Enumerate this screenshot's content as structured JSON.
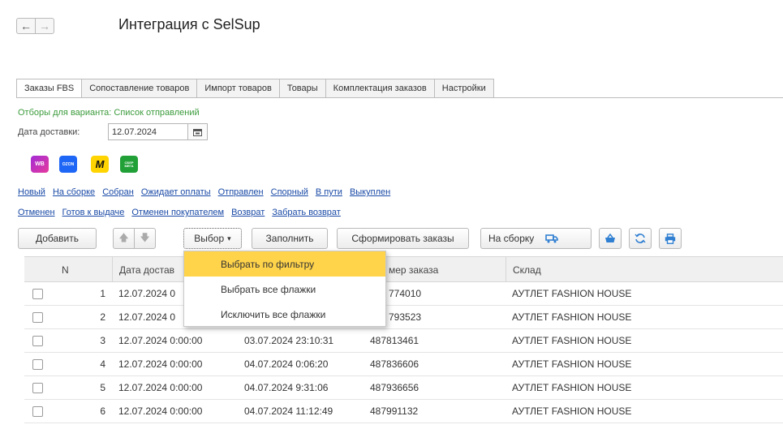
{
  "window": {
    "title": "Интеграция с SelSup",
    "back_glyph": "←",
    "forward_glyph": "→"
  },
  "tabs": [
    {
      "label": "Заказы FBS",
      "active": true
    },
    {
      "label": "Сопоставление товаров",
      "active": false
    },
    {
      "label": "Импорт товаров",
      "active": false
    },
    {
      "label": "Товары",
      "active": false
    },
    {
      "label": "Комплектация заказов",
      "active": false
    },
    {
      "label": "Настройки",
      "active": false
    }
  ],
  "filters": {
    "caption": "Отборы для варианта: Список отправлений",
    "date_label": "Дата доставки:",
    "date_value": "12.07.2024"
  },
  "marketplaces": [
    {
      "name": "wb",
      "label": "WB",
      "color": "#a32cd6"
    },
    {
      "name": "ozon",
      "label": "OZON",
      "color": "#1e66f5"
    },
    {
      "name": "yandex-market",
      "label": "M",
      "color": "#ffd400"
    },
    {
      "name": "sber",
      "label": "СБЕР МЕГА",
      "color": "#21a038"
    }
  ],
  "statuses_row1": [
    "Новый",
    "На сборке",
    "Собран",
    "Ожидает оплаты",
    "Отправлен",
    "Спорный",
    "В пути",
    "Выкуплен"
  ],
  "statuses_row2": [
    "Отменен",
    "Готов к выдаче",
    "Отменен покупателем",
    "Возврат",
    "Забрать возврат"
  ],
  "toolbar": {
    "add_label": "Добавить",
    "up_glyph": "🡅",
    "down_glyph": "🡇",
    "choose_label": "Выбор",
    "fill_label": "Заполнить",
    "form_orders_label": "Сформировать заказы",
    "to_assembly_label": "На сборку",
    "accent_color": "#2f7fd2"
  },
  "dropdown": {
    "items": [
      "Выбрать по фильтру",
      "Выбрать все флажки",
      "Исключить все флажки"
    ],
    "highlight_color": "#ffd34a"
  },
  "table": {
    "columns": [
      "N",
      "Дата достав",
      "мер заказа",
      "Склад"
    ],
    "rows": [
      {
        "n": "1",
        "delivery": "12.07.2024 0",
        "created": "",
        "order": "774010",
        "warehouse": "АУТЛЕТ FASHION HOUSE"
      },
      {
        "n": "2",
        "delivery": "12.07.2024 0",
        "created": "",
        "order": "793523",
        "warehouse": "АУТЛЕТ FASHION HOUSE"
      },
      {
        "n": "3",
        "delivery": "12.07.2024 0:00:00",
        "created": "03.07.2024 23:10:31",
        "order": "487813461",
        "warehouse": "АУТЛЕТ FASHION HOUSE"
      },
      {
        "n": "4",
        "delivery": "12.07.2024 0:00:00",
        "created": "04.07.2024 0:06:20",
        "order": "487836606",
        "warehouse": "АУТЛЕТ FASHION HOUSE"
      },
      {
        "n": "5",
        "delivery": "12.07.2024 0:00:00",
        "created": "04.07.2024 9:31:06",
        "order": "487936656",
        "warehouse": "АУТЛЕТ FASHION HOUSE"
      },
      {
        "n": "6",
        "delivery": "12.07.2024 0:00:00",
        "created": "04.07.2024 11:12:49",
        "order": "487991132",
        "warehouse": "АУТЛЕТ FASHION HOUSE"
      }
    ]
  }
}
